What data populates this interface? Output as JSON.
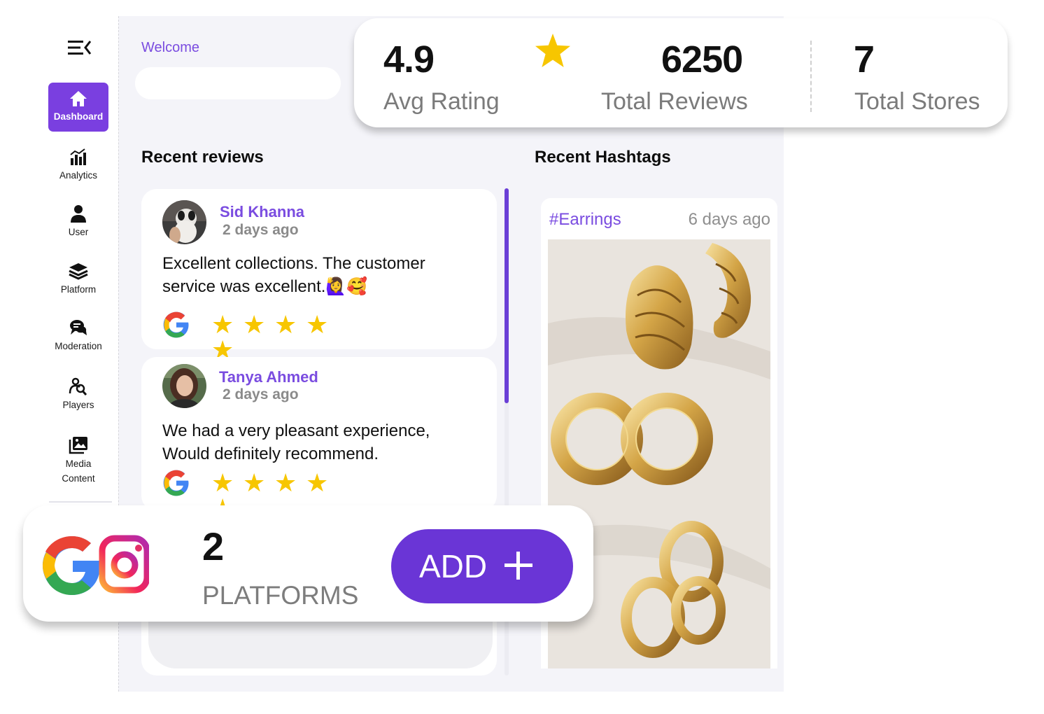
{
  "sidebar": {
    "items": [
      {
        "label": "Dashboard",
        "icon": "home-icon"
      },
      {
        "label": "Analytics",
        "icon": "analytics-icon"
      },
      {
        "label": "User",
        "icon": "user-icon"
      },
      {
        "label": "Platform",
        "icon": "layers-icon"
      },
      {
        "label": "Moderation",
        "icon": "chat-icon"
      },
      {
        "label": "Players",
        "icon": "players-icon"
      },
      {
        "label": "Media",
        "label2": "Content",
        "icon": "media-icon"
      }
    ]
  },
  "welcome": {
    "text": "Welcome"
  },
  "stats": {
    "avg_rating_value": "4.9",
    "avg_rating_label": "Avg Rating",
    "total_reviews_value": "6250",
    "total_reviews_label": "Total Reviews",
    "total_stores_value": "7",
    "total_stores_label": "Total Stores"
  },
  "reviews": {
    "title": "Recent reviews",
    "items": [
      {
        "name": "Sid Khanna",
        "time": "2 days ago",
        "text": "Excellent collections.  The customer service was excellent.🙋‍♀️🥰",
        "rating": 5,
        "platform": "Google"
      },
      {
        "name": "Tanya Ahmed",
        "time": "2 days ago",
        "text": "We had a very pleasant experience, Would definitely recommend.",
        "rating": 5,
        "platform": "Google"
      }
    ]
  },
  "hashtags": {
    "title": "Recent Hashtags",
    "item": {
      "tag": "#Earrings",
      "time": "6 days ago"
    }
  },
  "platforms": {
    "count": "2",
    "label": "PLATFORMS",
    "add_label": "ADD"
  },
  "colors": {
    "accent": "#7a4ce0",
    "button": "#6a35d6",
    "star": "#f7c600"
  }
}
